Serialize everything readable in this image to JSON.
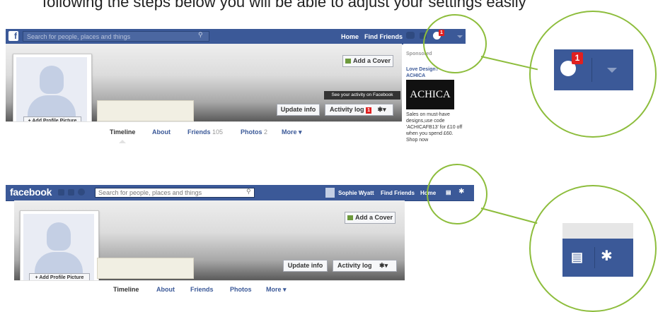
{
  "caption": "following the steps below you will be able to adjust your settings easily",
  "top": {
    "search_placeholder": "Search for people, places and things",
    "nav_home": "Home",
    "nav_find_friends": "Find Friends",
    "notif_count": "1",
    "add_cover": "Add a Cover",
    "add_profile_picture": "+ Add Profile Picture",
    "update_info": "Update info",
    "activity_log": "Activity log",
    "activity_count": "1",
    "tooltip": "See your activity on Facebook",
    "tabs": {
      "timeline": "Timeline",
      "about": "About",
      "friends": "Friends",
      "friends_count": "105",
      "photos": "Photos",
      "photos_count": "2",
      "more": "More"
    },
    "sponsored": {
      "label": "Sponsored",
      "ad_title": "Love Design? ACHICA",
      "ad_image_text": "ACHICA",
      "ad_text": "Sales on must-have designs,use code 'ACHICAFB13' for £10 off when you spend £60. Shop now"
    },
    "zoom_count": "1"
  },
  "bottom": {
    "logo": "facebook",
    "search_placeholder": "Search for people, places and things",
    "user_name": "Sophie Wyatt",
    "nav_find_friends": "Find Friends",
    "nav_home": "Home",
    "add_cover": "Add a Cover",
    "add_profile_picture": "+ Add Profile Picture",
    "update_info": "Update info",
    "activity_log": "Activity log",
    "tabs": {
      "timeline": "Timeline",
      "about": "About",
      "friends": "Friends",
      "photos": "Photos",
      "more": "More"
    }
  },
  "colors": {
    "fb_blue": "#3b5998",
    "highlight_green": "#8dbd3c",
    "notification_red": "#e02020"
  }
}
